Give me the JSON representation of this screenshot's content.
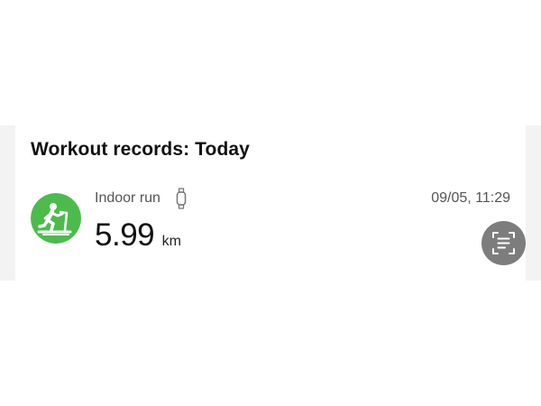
{
  "section": {
    "title": "Workout records: Today"
  },
  "records": [
    {
      "activity": "Indoor run",
      "activity_icon": "treadmill-runner-icon",
      "device_icon": "watch-icon",
      "timestamp": "09/05, 11:29",
      "distance_value": "5.99",
      "distance_unit": "km"
    }
  ],
  "colors": {
    "activity_icon_bg": "#4cbb4c",
    "scan_button_bg": "#7d7d7d",
    "page_band_bg": "#f3f3f3"
  },
  "floating": {
    "scan_icon": "scan-text-icon"
  }
}
